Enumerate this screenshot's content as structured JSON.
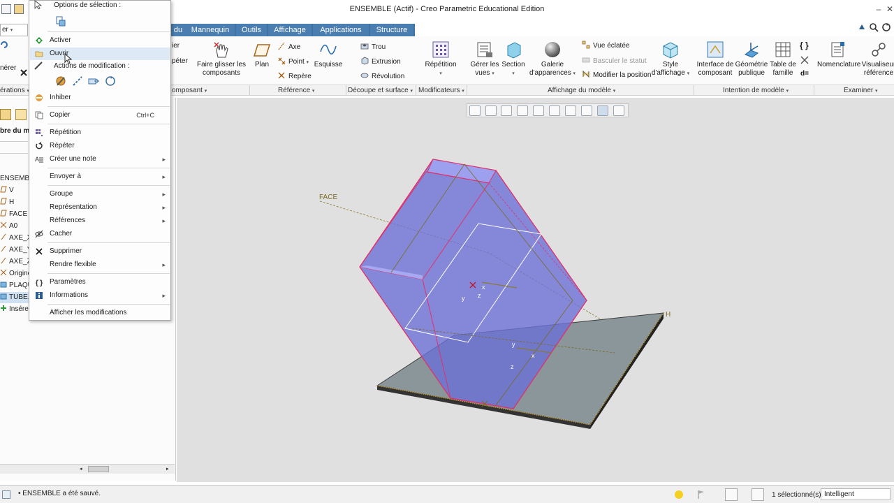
{
  "window": {
    "title": "ENSEMBLE (Actif) - Creo Parametric Educational Edition"
  },
  "tabs": [
    {
      "label": "du"
    },
    {
      "label": "Mannequin"
    },
    {
      "label": "Outils"
    },
    {
      "label": "Affichage"
    },
    {
      "label": "Applications"
    },
    {
      "label": "Structure"
    }
  ],
  "ribbon": {
    "left_partial": {
      "top": "er",
      "middle": "nérer"
    },
    "composant_partial": {
      "top": "ier",
      "bottom": "péter"
    },
    "faire_glisser": "Faire glisser les composants",
    "plan": "Plan",
    "axe": "Axe",
    "point": "Point",
    "repere": "Repère",
    "esquisse": "Esquisse",
    "trou": "Trou",
    "extrusion": "Extrusion",
    "revolution": "Révolution",
    "repetition": "Répétition",
    "gerer_vues": "Gérer les vues",
    "section": "Section",
    "galerie": "Galerie d'apparences",
    "vue_eclatee": "Vue éclatée",
    "basculer_statut": "Basculer le statut",
    "modifier_position": "Modifier la position",
    "style_affichage": "Style d'affichage",
    "interface_composant": "Interface de composant",
    "geometrie_publique": "Géométrie publique",
    "table_famille": "Table de famille",
    "nomenclature": "Nomenclature",
    "visualiseur": "Visualiseur référence"
  },
  "groups": [
    {
      "label": "érations"
    },
    {
      "label": "omposant"
    },
    {
      "label": "Référence"
    },
    {
      "label": "Découpe et surface"
    },
    {
      "label": "Modificateurs"
    },
    {
      "label": "Affichage du modèle"
    },
    {
      "label": "Intention de modèle"
    },
    {
      "label": "Examiner"
    }
  ],
  "tree": {
    "header": "bre du m",
    "items": [
      {
        "label": "ENSEMBLE"
      },
      {
        "label": "V"
      },
      {
        "label": "H"
      },
      {
        "label": "FACE"
      },
      {
        "label": "A0"
      },
      {
        "label": "AXE_X"
      },
      {
        "label": "AXE_Y"
      },
      {
        "label": "AXE_Z"
      },
      {
        "label": "Origine"
      },
      {
        "label": "PLAQU"
      },
      {
        "label": "TUBE.F"
      },
      {
        "label": "Insérer"
      }
    ]
  },
  "context_menu": {
    "header_selection": "Options de sélection :",
    "header_modification": "Actions de modification :",
    "items": [
      {
        "label": "Activer",
        "shortcut": "",
        "submenu": false,
        "icon": "activate-icon"
      },
      {
        "label": "Ouvrir",
        "shortcut": "",
        "submenu": false,
        "icon": "open-folder-icon"
      },
      {
        "label": "Inhiber",
        "shortcut": "",
        "submenu": false,
        "icon": "suppress-icon"
      },
      {
        "label": "Copier",
        "shortcut": "Ctrl+C",
        "submenu": false,
        "icon": "copy-icon"
      },
      {
        "label": "Répétition",
        "shortcut": "",
        "submenu": false,
        "icon": "pattern-icon"
      },
      {
        "label": "Répéter",
        "shortcut": "",
        "submenu": false,
        "icon": "repeat-icon"
      },
      {
        "label": "Créer une note",
        "shortcut": "",
        "submenu": true,
        "icon": "note-icon"
      },
      {
        "label": "Envoyer à",
        "shortcut": "",
        "submenu": true,
        "icon": ""
      },
      {
        "label": "Groupe",
        "shortcut": "",
        "submenu": true,
        "icon": ""
      },
      {
        "label": "Représentation",
        "shortcut": "",
        "submenu": true,
        "icon": ""
      },
      {
        "label": "Références",
        "shortcut": "",
        "submenu": true,
        "icon": ""
      },
      {
        "label": "Cacher",
        "shortcut": "",
        "submenu": false,
        "icon": "hide-icon"
      },
      {
        "label": "Supprimer",
        "shortcut": "",
        "submenu": false,
        "icon": "delete-icon"
      },
      {
        "label": "Rendre flexible",
        "shortcut": "",
        "submenu": true,
        "icon": ""
      },
      {
        "label": "Paramètres",
        "shortcut": "",
        "submenu": false,
        "icon": "parameters-icon"
      },
      {
        "label": "Informations",
        "shortcut": "",
        "submenu": true,
        "icon": "info-icon"
      },
      {
        "label": "Afficher les modifications",
        "shortcut": "",
        "submenu": false,
        "icon": ""
      }
    ]
  },
  "viewport_labels": {
    "face": "FACE",
    "h": "H",
    "axis_y1": "y",
    "axis_z1": "z",
    "axis_x1": "x",
    "axis_y2": "y",
    "axis_z2": "z",
    "axis_x2": "x"
  },
  "status": {
    "message": "ENSEMBLE a été sauvé.",
    "selection": "1 sélectionné(s)",
    "filter": "Intelligent"
  },
  "colors": {
    "tab_blue": "#4a7db0",
    "model_fill": "#6b6fd6",
    "edge_highlight": "#e0306a",
    "plate": "#8a969a"
  }
}
